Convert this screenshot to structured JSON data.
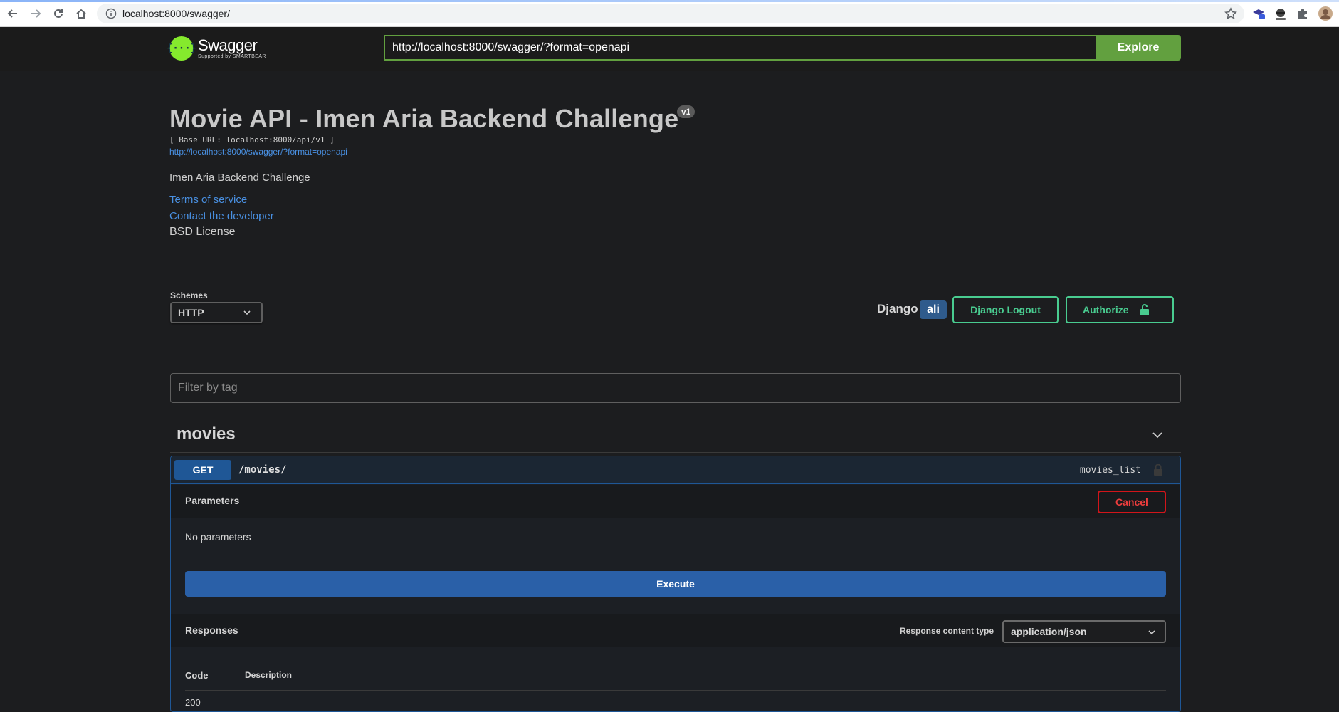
{
  "browser": {
    "url": "localhost:8000/swagger/"
  },
  "topbar": {
    "logo_name": "Swagger",
    "logo_sub": "Supported by SMARTBEAR",
    "spec_url": "http://localhost:8000/swagger/?format=openapi",
    "explore_label": "Explore"
  },
  "info": {
    "title": "Movie API - Imen Aria Backend Challenge",
    "version": "v1",
    "base_url": "[ Base URL: localhost:8000/api/v1 ]",
    "spec_link": "http://localhost:8000/swagger/?format=openapi",
    "description": "Imen Aria Backend Challenge",
    "terms": "Terms of service",
    "contact": "Contact the developer",
    "license": "BSD License"
  },
  "schemes": {
    "label": "Schemes",
    "selected": "HTTP"
  },
  "auth": {
    "django_label": "Django",
    "username": "ali",
    "logout_label": "Django Logout",
    "authorize_label": "Authorize"
  },
  "filter": {
    "placeholder": "Filter by tag"
  },
  "tag": {
    "name": "movies"
  },
  "operation": {
    "method": "GET",
    "path": "/movies/",
    "operation_id": "movies_list",
    "parameters_title": "Parameters",
    "cancel_label": "Cancel",
    "no_params": "No parameters",
    "execute_label": "Execute",
    "responses_title": "Responses",
    "response_content_type_label": "Response content type",
    "response_content_type": "application/json",
    "col_code": "Code",
    "col_description": "Description",
    "first_code": "200"
  },
  "colors": {
    "accent_green": "#62a03f",
    "get_blue": "#1f5796",
    "authorize_green": "#49cc90",
    "cancel_red": "#d2151a"
  }
}
